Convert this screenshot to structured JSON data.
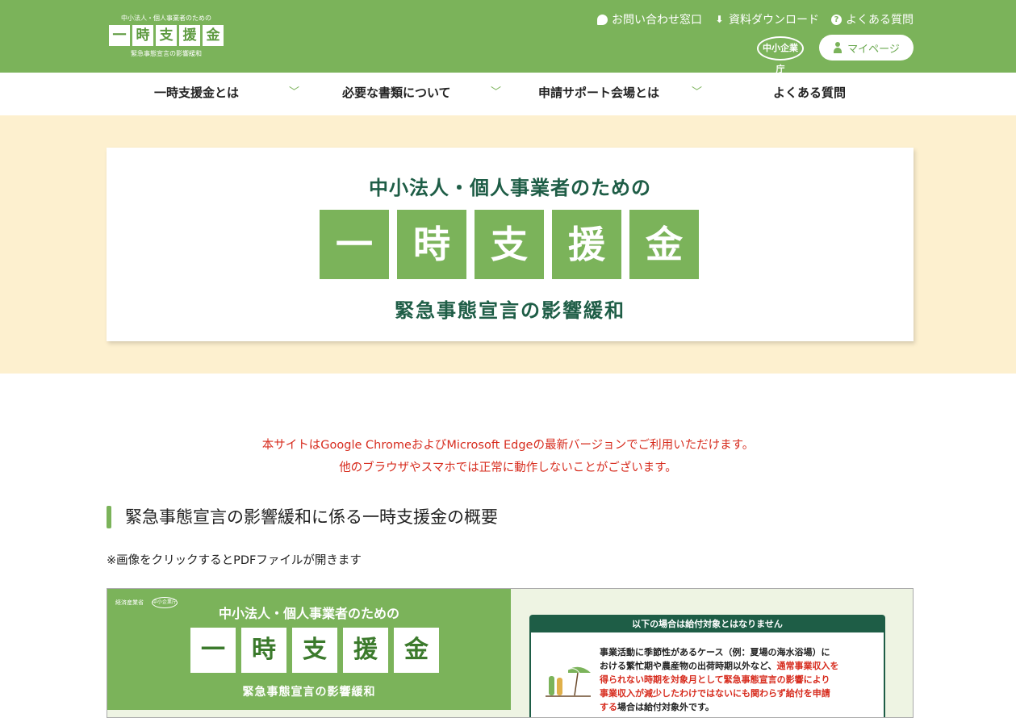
{
  "header": {
    "logo": {
      "top": "中小法人・個人事業者のための",
      "chars": [
        "一",
        "時",
        "支",
        "援",
        "金"
      ],
      "bottom": "緊急事態宣言の影響緩和"
    },
    "util_links": [
      {
        "label": "お問い合わせ窓口",
        "icon": "chat-bubble-icon"
      },
      {
        "label": "資料ダウンロード",
        "icon": "download-arrow-icon"
      },
      {
        "label": "よくある質問",
        "icon": "question-circle-icon"
      }
    ],
    "agency_logo": "中小企業庁",
    "mypage_label": "マイページ"
  },
  "nav": [
    {
      "label": "一時支援金とは",
      "has_dropdown": true
    },
    {
      "label": "必要な書類について",
      "has_dropdown": true
    },
    {
      "label": "申請サポート会場とは",
      "has_dropdown": true
    },
    {
      "label": "よくある質問",
      "has_dropdown": false
    }
  ],
  "hero": {
    "subtitle": "中小法人・個人事業者のための",
    "chars": [
      "一",
      "時",
      "支",
      "援",
      "金"
    ],
    "caption": "緊急事態宣言の影響緩和"
  },
  "notice": {
    "line1": "本サイトはGoogle ChromeおよびMicrosoft Edgeの最新バージョンでご利用いただけます。",
    "line2": "他のブラウザやスマホでは正常に動作しないことがございます。"
  },
  "section": {
    "title": "緊急事態宣言の影響緩和に係る一時支援金の概要",
    "pdf_note": "※画像をクリックするとPDFファイルが開きます"
  },
  "pdf_thumb": {
    "logo_meti": "経済産業省",
    "logo_sme": "中小企業庁",
    "subtitle": "中小法人・個人事業者のための",
    "chars": [
      "一",
      "時",
      "支",
      "援",
      "金"
    ],
    "caption": "緊急事態宣言の影響緩和",
    "panel_title": "以下の場合は給付対象とはなりません",
    "panel_text_1": "事業活動に季節性があるケース（例：夏場の海水浴場）に",
    "panel_text_2": "おける繁忙期や農産物の出荷時期以外など、",
    "panel_text_2_red": "通常事業収入を",
    "panel_text_3_red": "得られない時期を対象月として緊急事態宣言の影響により",
    "panel_text_4_red": "事業収入が減少したわけではないにも関わらず給付を申請",
    "panel_text_5_red": "する",
    "panel_text_5": "場合は給付対象外です。"
  },
  "colors": {
    "brand_green": "#7bb35a",
    "dark_green": "#1e5d46",
    "hero_bg": "#fdf0cf",
    "notice_red": "#d72c1e"
  }
}
